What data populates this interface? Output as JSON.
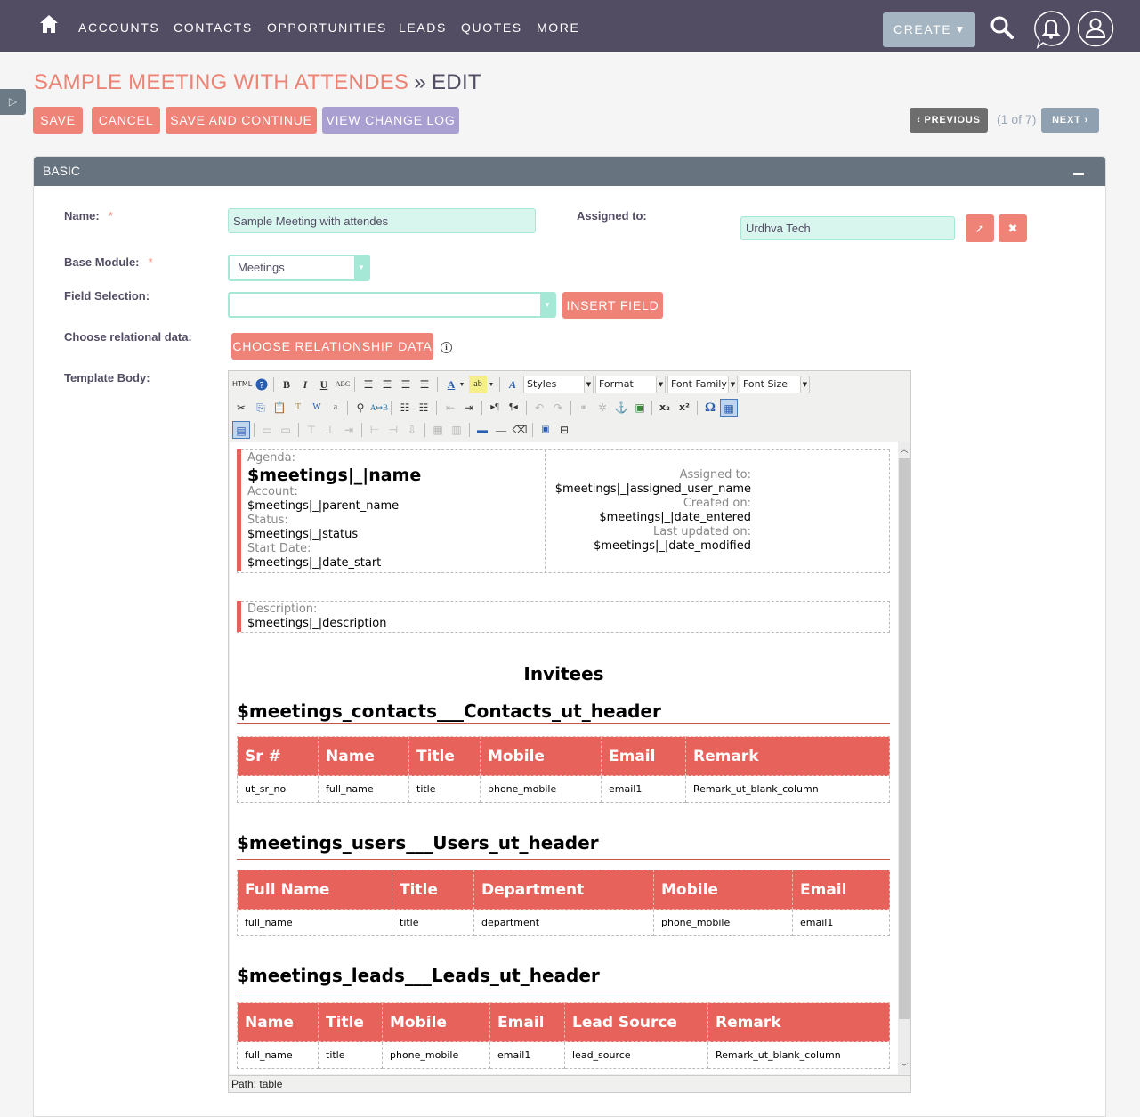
{
  "nav": {
    "items": [
      "ACCOUNTS",
      "CONTACTS",
      "OPPORTUNITIES",
      "LEADS",
      "QUOTES",
      "MORE"
    ],
    "create_label": "CREATE"
  },
  "page": {
    "module_title": "SAMPLE MEETING WITH ATTENDES",
    "separator": "»",
    "action": "EDIT"
  },
  "actions": {
    "save": "SAVE",
    "cancel": "CANCEL",
    "save_continue": "SAVE AND CONTINUE",
    "change_log": "VIEW CHANGE LOG",
    "previous": "PREVIOUS",
    "next": "NEXT",
    "page_count": "(1 of 7)"
  },
  "panel": {
    "title": "BASIC"
  },
  "form": {
    "name_label": "Name:",
    "name_value": "Sample Meeting with attendes",
    "assigned_label": "Assigned to:",
    "assigned_value": "Urdhva Tech",
    "base_module_label": "Base Module:",
    "base_module_value": "Meetings",
    "field_selection_label": "Field Selection:",
    "field_selection_value": "",
    "insert_field": "INSERT FIELD",
    "relational_label": "Choose relational data:",
    "relationship_button": "CHOOSE RELATIONSHIP DATA",
    "template_body_label": "Template Body:",
    "required_mark": "*"
  },
  "editor": {
    "dropdowns": [
      "Styles",
      "Format",
      "Font Family",
      "Font Size"
    ],
    "path": "Path: table",
    "summary_left": [
      {
        "caption": "Agenda:",
        "value": "$meetings|_|name"
      },
      {
        "caption": "Account:",
        "value": "$meetings|_|parent_name"
      },
      {
        "caption": "Status:",
        "value": "$meetings|_|status"
      },
      {
        "caption": "Start Date:",
        "value": "$meetings|_|date_start"
      }
    ],
    "summary_right": [
      {
        "caption": "Assigned to:",
        "value": "$meetings|_|assigned_user_name"
      },
      {
        "caption": "Created on:",
        "value": "$meetings|_|date_entered"
      },
      {
        "caption": "Last updated on:",
        "value": "$meetings|_|date_modified"
      }
    ],
    "description": {
      "caption": "Description:",
      "value": "$meetings|_|description"
    },
    "invitees_title": "Invitees",
    "sections": [
      {
        "title": "$meetings_contacts___Contacts_ut_header",
        "headers": [
          "Sr #",
          "Name",
          "Title",
          "Mobile",
          "Email",
          "Remark"
        ],
        "row": [
          "ut_sr_no",
          "full_name",
          "title",
          "phone_mobile",
          "email1",
          "Remark_ut_blank_column"
        ]
      },
      {
        "title": "$meetings_users___Users_ut_header",
        "headers": [
          "Full Name",
          "Title",
          "Department",
          "Mobile",
          "Email"
        ],
        "row": [
          "full_name",
          "title",
          "department",
          "phone_mobile",
          "email1"
        ]
      },
      {
        "title": "$meetings_leads___Leads_ut_header",
        "headers": [
          "Name",
          "Title",
          "Mobile",
          "Email",
          "Lead Source",
          "Remark"
        ],
        "row": [
          "full_name",
          "title",
          "phone_mobile",
          "email1",
          "lead_source",
          "Remark_ut_blank_column"
        ]
      }
    ]
  },
  "colors": {
    "nav_bg": "#534d64",
    "accent_red": "#f08377",
    "accent_purple": "#a99fd0",
    "table_header": "#e7625a",
    "input_bg": "#d8f5ee"
  }
}
